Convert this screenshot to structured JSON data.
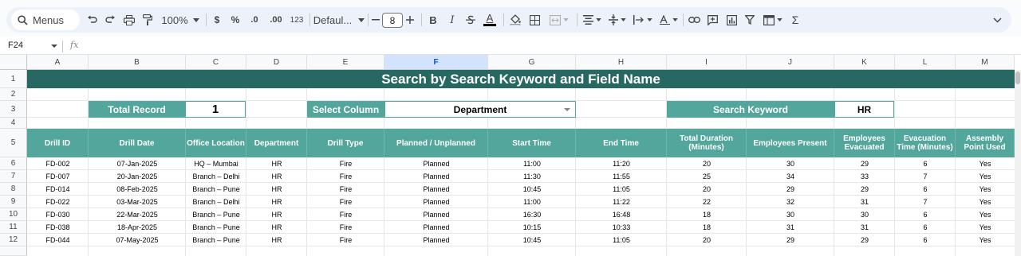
{
  "toolbar": {
    "menus_label": "Menus",
    "zoom": "100%",
    "currency_symbol": "$",
    "percent_symbol": "%",
    "decrease_decimals": ".0",
    "increase_decimals": ".00",
    "number_format": "123",
    "font": "Defaul...",
    "font_size": "8",
    "bold": "B",
    "italic": "I",
    "text_color_letter": "A",
    "sum_symbol": "Σ"
  },
  "formula_bar": {
    "cell_ref": "F24",
    "fx": "fx",
    "content": ""
  },
  "columns": [
    "A",
    "B",
    "C",
    "D",
    "E",
    "F",
    "G",
    "H",
    "I",
    "J",
    "K",
    "L",
    "M"
  ],
  "selected_column": "F",
  "rows": [
    "1",
    "2",
    "3",
    "4",
    "5",
    "6",
    "7",
    "8",
    "9",
    "10",
    "11",
    "12",
    ""
  ],
  "sheet": {
    "title": "Search by Search Keyword and Field Name",
    "total_record_label": "Total Record",
    "total_record_value": "1",
    "select_column_label": "Select Column",
    "select_column_value": "Department",
    "search_keyword_label": "Search Keyword",
    "search_keyword_value": "HR",
    "headers": [
      "Drill ID",
      "Drill Date",
      "Office Location",
      "Department",
      "Drill Type",
      "Planned / Unplanned",
      "Start Time",
      "End Time",
      "Total Duration (Minutes)",
      "Employees Present",
      "Employees Evacuated",
      "Evacuation Time (Minutes)",
      "Assembly Point Used"
    ],
    "table_rows": [
      [
        "FD-002",
        "07-Jan-2025",
        "HQ – Mumbai",
        "HR",
        "Fire",
        "Planned",
        "11:00",
        "11:20",
        "20",
        "30",
        "29",
        "6",
        "Yes"
      ],
      [
        "FD-007",
        "20-Jan-2025",
        "Branch – Delhi",
        "HR",
        "Fire",
        "Planned",
        "11:30",
        "11:55",
        "25",
        "34",
        "33",
        "7",
        "Yes"
      ],
      [
        "FD-014",
        "08-Feb-2025",
        "Branch – Pune",
        "HR",
        "Fire",
        "Planned",
        "10:45",
        "11:05",
        "20",
        "29",
        "29",
        "6",
        "Yes"
      ],
      [
        "FD-022",
        "03-Mar-2025",
        "Branch – Delhi",
        "HR",
        "Fire",
        "Planned",
        "11:00",
        "11:22",
        "22",
        "32",
        "31",
        "7",
        "Yes"
      ],
      [
        "FD-030",
        "22-Mar-2025",
        "Branch – Pune",
        "HR",
        "Fire",
        "Planned",
        "16:30",
        "16:48",
        "18",
        "30",
        "30",
        "6",
        "Yes"
      ],
      [
        "FD-038",
        "18-Apr-2025",
        "Branch – Pune",
        "HR",
        "Fire",
        "Planned",
        "10:15",
        "10:33",
        "18",
        "31",
        "31",
        "6",
        "Yes"
      ],
      [
        "FD-044",
        "07-May-2025",
        "Branch – Pune",
        "HR",
        "Fire",
        "Planned",
        "10:45",
        "11:05",
        "20",
        "29",
        "29",
        "6",
        "Yes"
      ]
    ]
  },
  "colors": {
    "title_band": "#276962",
    "label_fill": "#53a69b",
    "selected_column_header": "#d3e3fd"
  }
}
